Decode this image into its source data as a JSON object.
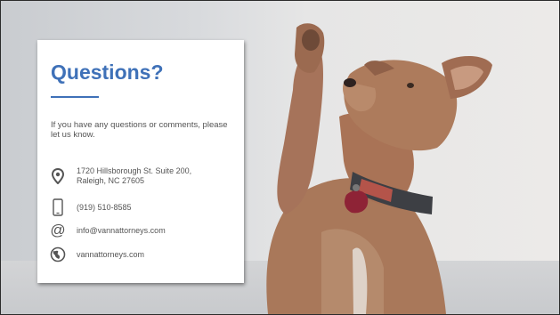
{
  "slide": {
    "title": "Questions?",
    "intro": "If you have any questions or comments, please let us know.",
    "contacts": {
      "address_line1": "1720 Hillsborough St. Suite 200,",
      "address_line2": "Raleigh, NC 27605",
      "phone": "(919) 510-8585",
      "email": "info@vannattorneys.com",
      "website": "vannattorneys.com"
    }
  },
  "icons": [
    "map-pin-icon",
    "phone-icon",
    "at-sign-icon",
    "globe-icon"
  ],
  "colors": {
    "accent": "#3f71b8",
    "text": "#555555",
    "card": "#ffffff"
  }
}
